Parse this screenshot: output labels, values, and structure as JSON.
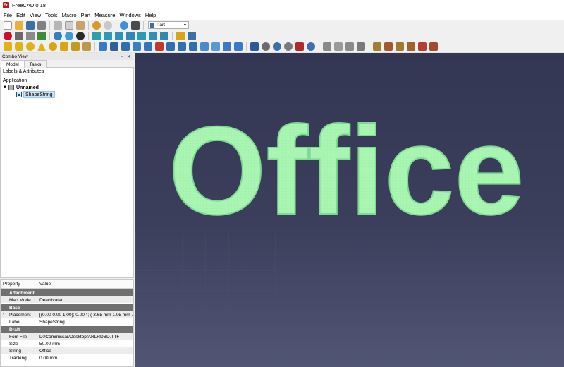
{
  "window": {
    "title": "FreeCAD 0.18",
    "logo": "Fc"
  },
  "menu": [
    "File",
    "Edit",
    "View",
    "Tools",
    "Macro",
    "Part",
    "Measure",
    "Windows",
    "Help"
  ],
  "toolbar": {
    "workbench": "Part"
  },
  "combo_view": {
    "title": "Combo View",
    "controls": "▫ ✕",
    "tabs": [
      "Model",
      "Tasks"
    ],
    "active_tab": "Model"
  },
  "tree": {
    "header": "Labels & Attributes",
    "section": "Application",
    "document": "Unnamed",
    "child": "ShapeString"
  },
  "properties": {
    "col_property": "Property",
    "col_value": "Value",
    "groups": [
      {
        "name": "Attachment",
        "rows": [
          {
            "name": "Map Mode",
            "value": "Deactivated"
          }
        ]
      },
      {
        "name": "Base",
        "rows": [
          {
            "name": "Placement",
            "value": "[(0.00 0.00 1.00); 0.00 °; (-3.65 mm  1.05 mm ...",
            "expandable": true
          },
          {
            "name": "Label",
            "value": "ShapeString"
          }
        ]
      },
      {
        "name": "Draft",
        "rows": [
          {
            "name": "Font File",
            "value": "D:/Commissar/Desktop/ARLRDBD.TTF"
          },
          {
            "name": "Size",
            "value": "50.00 mm"
          },
          {
            "name": "String",
            "value": "Office"
          },
          {
            "name": "Tracking",
            "value": "0.00 mm"
          }
        ]
      }
    ]
  },
  "viewport": {
    "text": "Office",
    "text_color": "#a9f5b2",
    "outline_color": "#7fd893"
  },
  "colors": {
    "selection": "#cce4f7",
    "group_header": "#707070",
    "accent_red": "#b81c1c"
  }
}
